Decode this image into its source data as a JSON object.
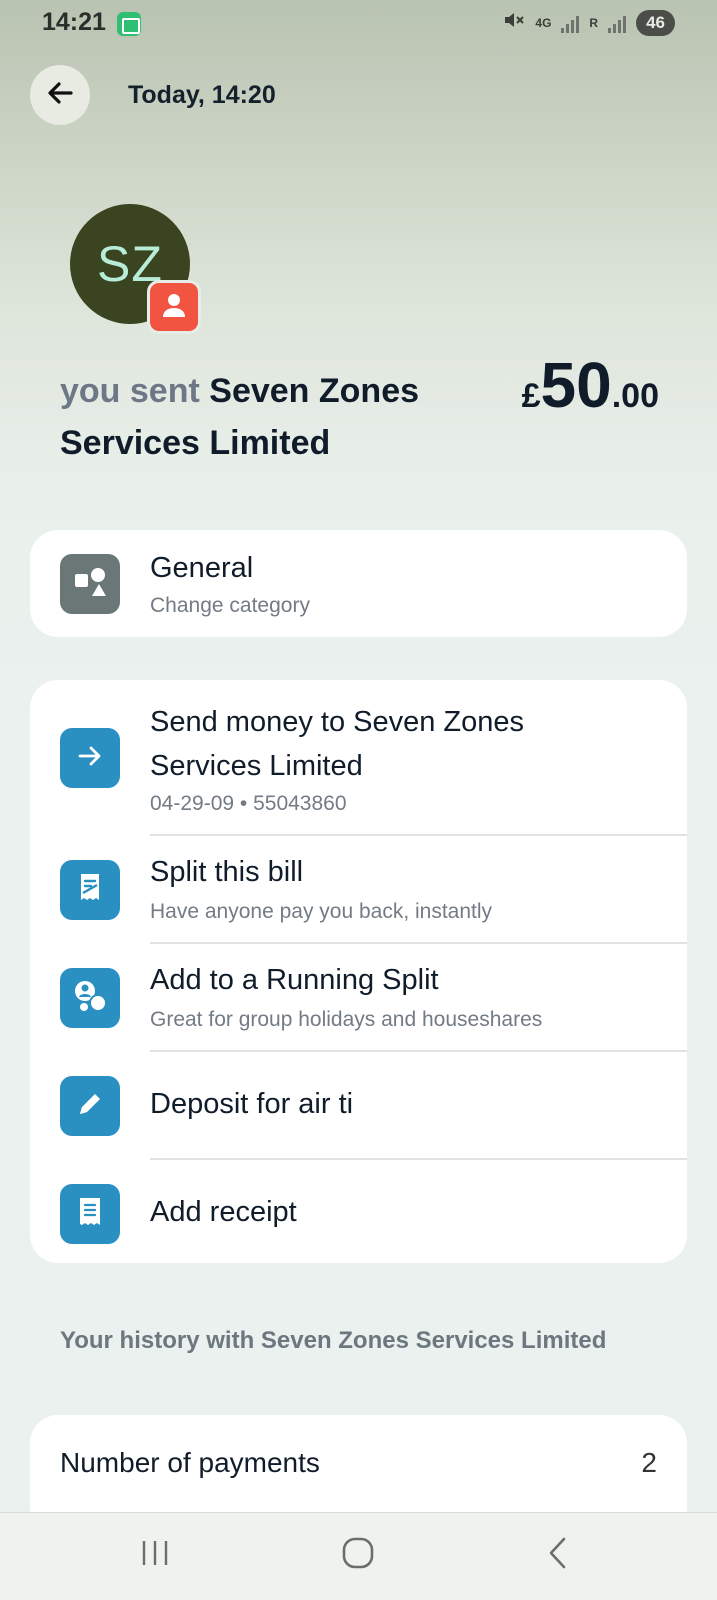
{
  "status_bar": {
    "time": "14:21",
    "network": "4G",
    "roaming": "R",
    "battery": "46"
  },
  "header": {
    "title": "Today, 14:20"
  },
  "avatar": {
    "initials": "SZ"
  },
  "transaction": {
    "prefix": "you sent",
    "payee": "Seven Zones Services Limited",
    "currency_symbol": "£",
    "amount_whole": "50",
    "amount_decimal": ".00"
  },
  "category": {
    "title": "General",
    "subtitle": "Change category"
  },
  "actions": {
    "send_money": {
      "title": "Send money to Seven Zones Services Limited",
      "subtitle": "04-29-09 • 55043860"
    },
    "split_bill": {
      "title": "Split this bill",
      "subtitle": "Have anyone pay you back, instantly"
    },
    "running_split": {
      "title": "Add to a Running Split",
      "subtitle": "Great for group holidays and houseshares"
    },
    "note": {
      "title": "Deposit for air ti"
    },
    "receipt": {
      "title": "Add receipt"
    }
  },
  "history": {
    "title": "Your history with Seven Zones Services Limited",
    "rows": [
      {
        "label": "Number of payments",
        "value": "2"
      }
    ]
  },
  "colors": {
    "accent_blue": "#2a8fc1",
    "badge_red": "#f25442",
    "avatar_bg": "#3a4420"
  },
  "icons": [
    "back-arrow-icon",
    "person-icon",
    "shapes-icon",
    "arrow-right-icon",
    "split-bill-icon",
    "group-icon",
    "pencil-icon",
    "receipt-icon"
  ]
}
